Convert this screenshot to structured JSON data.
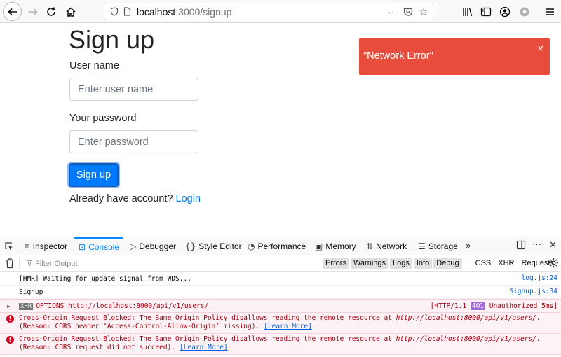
{
  "browser": {
    "url_host": "localhost",
    "url_rest": ":3000/signup"
  },
  "page": {
    "title": "Sign up",
    "username_label": "User name",
    "username_placeholder": "Enter user name",
    "password_label": "Your password",
    "password_placeholder": "Enter password",
    "signup_button": "Sign up",
    "already_text": "Already have account?",
    "login_link": "Login"
  },
  "toast": {
    "message": "\"Network Error\"",
    "close": "×"
  },
  "devtools": {
    "tabs": {
      "inspector": "Inspector",
      "console": "Console",
      "debugger": "Debugger",
      "style_editor": "Style Editor",
      "performance": "Performance",
      "memory": "Memory",
      "network": "Network",
      "storage": "Storage"
    },
    "filter_placeholder": "Filter Output",
    "levels": {
      "errors": "Errors",
      "warnings": "Warnings",
      "logs": "Logs",
      "info": "Info",
      "debug": "Debug",
      "css": "CSS",
      "xhr": "XHR",
      "requests": "Requests"
    },
    "logs": {
      "hmr_msg": "[HMR] Waiting for update signal from WDS...",
      "hmr_src": "log.js:24",
      "signup_msg": "Signup",
      "signup_src": "Signup.js:34",
      "xhr_badge": "XHR",
      "xhr_msg": "OPTIONS http://localhost:8000/api/v1/users/",
      "xhr_proto": "[HTTP/1.1",
      "xhr_code": "401",
      "xhr_status": "Unauthorized 5ms]",
      "err1_prefix": "Cross-Origin Request Blocked: The Same Origin Policy disallows reading the remote resource at ",
      "err1_url": "http://localhost:8000/api/v1/users/",
      "err1_suffix": ".",
      "err1_line2": "(Reason: CORS header ‘Access-Control-Allow-Origin’ missing).",
      "err2_prefix": "Cross-Origin Request Blocked: The Same Origin Policy disallows reading the remote resource at ",
      "err2_url": "http://localhost:8000/api/v1/users/",
      "err2_suffix": ".",
      "err2_line2": "(Reason: CORS request did not succeed).",
      "learn_more": "[Learn More]"
    }
  }
}
